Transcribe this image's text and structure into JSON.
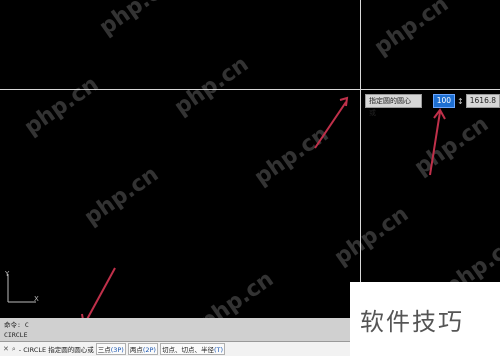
{
  "watermark_text": "php.cn",
  "dynamic_input": {
    "prompt": "指定圆的圆心或",
    "x_value": "100",
    "separator": "↕",
    "y_value": "1616.8"
  },
  "ucs": {
    "x_label": "X",
    "y_label": "Y"
  },
  "command_line": {
    "history": [
      "命令: C",
      "CIRCLE"
    ],
    "close_glyph": "✕",
    "search_glyph": "⌕",
    "prompt": "- CIRCLE 指定圆的圆心或",
    "options": [
      {
        "text": "三点",
        "key": "(3P)"
      },
      {
        "text": "两点",
        "key": "(2P)"
      },
      {
        "text": "切点、切点、半径",
        "key": "(T)"
      }
    ]
  },
  "logo_text": "软件技巧",
  "colors": {
    "canvas_bg": "#000000",
    "highlight": "#1e6fd2",
    "arrow": "#c0304a"
  }
}
